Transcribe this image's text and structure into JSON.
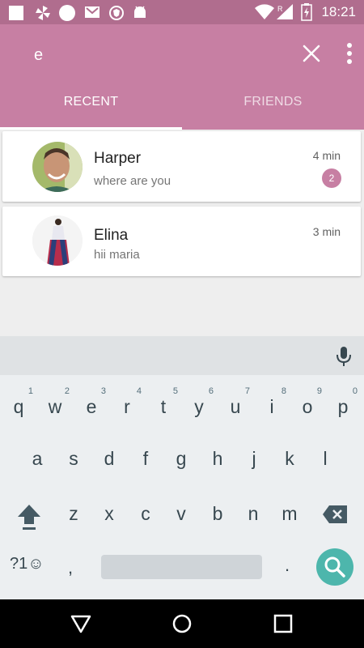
{
  "status_bar": {
    "time": "18:21",
    "icons": [
      "square-icon",
      "pinwheel-icon",
      "circle-icon",
      "gmail-icon",
      "brave-icon",
      "android-icon",
      "wifi-icon",
      "signal-r-icon",
      "battery-charging-icon"
    ]
  },
  "appbar": {
    "search_value": "e",
    "search_placeholder": "",
    "tabs": [
      {
        "label": "RECENT",
        "selected": true
      },
      {
        "label": "FRIENDS",
        "selected": false
      }
    ],
    "colors": {
      "appbar": "#c77fa3",
      "status_bar": "#b06d8e"
    }
  },
  "chats": [
    {
      "name": "Harper",
      "message": "where are you",
      "time": "4 min",
      "unread": "2",
      "avatar": "man-avatar"
    },
    {
      "name": "Elina",
      "message": "hii maria",
      "time": "3 min",
      "unread": null,
      "avatar": "woman-avatar"
    }
  ],
  "keyboard": {
    "row1": [
      {
        "ch": "q",
        "hint": "1"
      },
      {
        "ch": "w",
        "hint": "2"
      },
      {
        "ch": "e",
        "hint": "3"
      },
      {
        "ch": "r",
        "hint": "4"
      },
      {
        "ch": "t",
        "hint": "5"
      },
      {
        "ch": "y",
        "hint": "6"
      },
      {
        "ch": "u",
        "hint": "7"
      },
      {
        "ch": "i",
        "hint": "8"
      },
      {
        "ch": "o",
        "hint": "9"
      },
      {
        "ch": "p",
        "hint": "0"
      }
    ],
    "row2": [
      "a",
      "s",
      "d",
      "f",
      "g",
      "h",
      "j",
      "k",
      "l"
    ],
    "row3": [
      "z",
      "x",
      "c",
      "v",
      "b",
      "n",
      "m"
    ],
    "symbols_label": "?1☺",
    "comma": ",",
    "period": ".",
    "accent_color": "#4db6ac"
  },
  "nav": [
    "back-icon",
    "home-icon",
    "recents-icon"
  ]
}
